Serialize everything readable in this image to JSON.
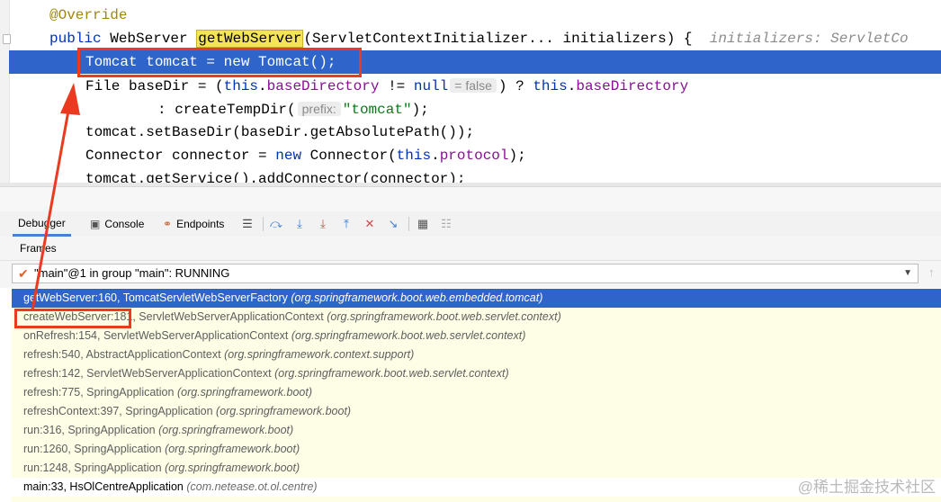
{
  "editor": {
    "lines": {
      "l1": {
        "annotation": "@Override"
      },
      "l2": {
        "kw": "public",
        "type": " WebServer ",
        "method": "getWebServer",
        "params": "(ServletContextInitializer... initializers) {",
        "debug": "initializers: ServletCo"
      },
      "l3": {
        "text": "Tomcat tomcat = new Tomcat();"
      },
      "l4": {
        "pre": "File baseDir = (",
        "this": "this",
        "dot": ".",
        "field": "baseDirectory",
        "mid": " != ",
        "null": "null",
        "hint": "= false",
        "post": ") ? ",
        "this2": "this",
        "dot2": ".",
        "field2": "baseDirectory"
      },
      "l5": {
        "pre": ": createTempDir(",
        "hint": "prefix:",
        "str": "\"tomcat\"",
        "post": ");"
      },
      "l6": {
        "text": "tomcat.setBaseDir(baseDir.getAbsolutePath());"
      },
      "l7": {
        "pre": "Connector connector = ",
        "new": "new",
        "mid": " Connector(",
        "this": "this",
        "dot": ".",
        "field": "protocol",
        "post": ");"
      },
      "l8": {
        "text": "tomcat.getService().addConnector(connector);"
      }
    }
  },
  "debugger": {
    "tabs": {
      "debugger": "Debugger",
      "console": "Console",
      "endpoints": "Endpoints"
    },
    "frames_label": "Frames",
    "thread": "\"main\"@1 in group \"main\": RUNNING",
    "frames": [
      {
        "method": "getWebServer:160, TomcatServletWebServerFactory",
        "pkg": "(org.springframework.boot.web.embedded.tomcat)"
      },
      {
        "method": "createWebServer:181, ServletWebServerApplicationContext",
        "pkg": "(org.springframework.boot.web.servlet.context)"
      },
      {
        "method": "onRefresh:154, ServletWebServerApplicationContext",
        "pkg": "(org.springframework.boot.web.servlet.context)"
      },
      {
        "method": "refresh:540, AbstractApplicationContext",
        "pkg": "(org.springframework.context.support)"
      },
      {
        "method": "refresh:142, ServletWebServerApplicationContext",
        "pkg": "(org.springframework.boot.web.servlet.context)"
      },
      {
        "method": "refresh:775, SpringApplication",
        "pkg": "(org.springframework.boot)"
      },
      {
        "method": "refreshContext:397, SpringApplication",
        "pkg": "(org.springframework.boot)"
      },
      {
        "method": "run:316, SpringApplication",
        "pkg": "(org.springframework.boot)"
      },
      {
        "method": "run:1260, SpringApplication",
        "pkg": "(org.springframework.boot)"
      },
      {
        "method": "run:1248, SpringApplication",
        "pkg": "(org.springframework.boot)"
      },
      {
        "method": "main:33, HsOlCentreApplication",
        "pkg": "(com.netease.ot.ol.centre)"
      }
    ]
  },
  "icons": {
    "debugger": "debugger-icon",
    "console": "console-icon",
    "endpoints": "endpoints-icon",
    "step": [
      "step-over-icon",
      "step-into-icon",
      "force-step-into-icon",
      "step-out-icon",
      "drop-frame-icon",
      "run-to-cursor-icon",
      "evaluate-icon",
      "trace-icon"
    ]
  },
  "colors": {
    "accent": "#2f65ca",
    "annotation_red": "#ea3b20",
    "frames_bg": "#fefee6"
  },
  "watermark": "@稀土掘金技术社区"
}
